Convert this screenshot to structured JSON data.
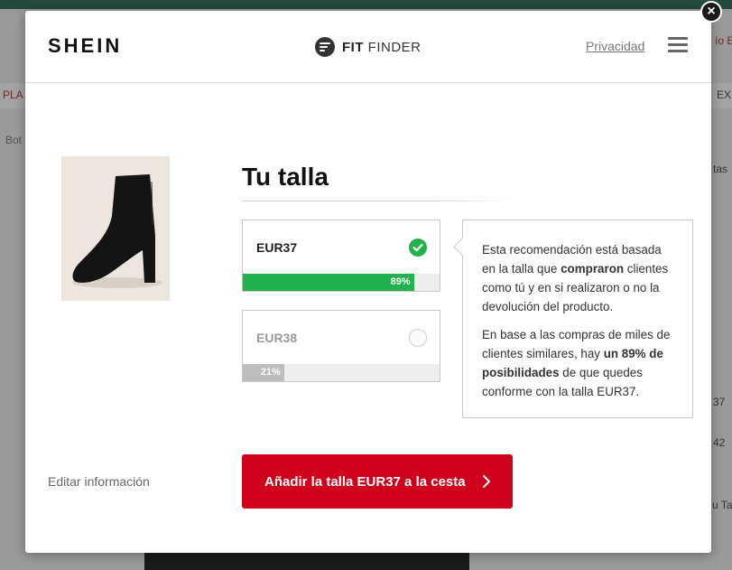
{
  "background": {
    "left_items": [
      "PLA",
      "Bot"
    ],
    "right_items": [
      "ío E",
      "EX",
      "tas",
      "37",
      "42",
      "u Ta"
    ]
  },
  "modal": {
    "close_label": "×",
    "brand": "SHEIN",
    "fitfinder": {
      "bold": "FIT",
      "regular": "FINDER"
    },
    "privacy": "Privacidad",
    "title": "Tu talla",
    "sizes": [
      {
        "label": "EUR37",
        "probability": "89%",
        "probability_value": 0.89,
        "selected": true
      },
      {
        "label": "EUR38",
        "probability": "21%",
        "probability_value": 0.21,
        "selected": false
      }
    ],
    "info": {
      "p1_a": "Esta recomendación está basada en la talla que ",
      "p1_b": "compraron",
      "p1_c": " clientes como tú y en si realizaron o no la devolución del producto.",
      "p2_a": "En base a las compras de miles de clientes similares, hay ",
      "p2_b": "un 89% de posibilidades",
      "p2_c": " de que quedes conforme con la talla EUR37."
    },
    "edit_info": "Editar información",
    "add_button": "Añadir la talla EUR37 a la cesta"
  },
  "colors": {
    "accent_red": "#d0021b",
    "success_green": "#22b14c"
  }
}
